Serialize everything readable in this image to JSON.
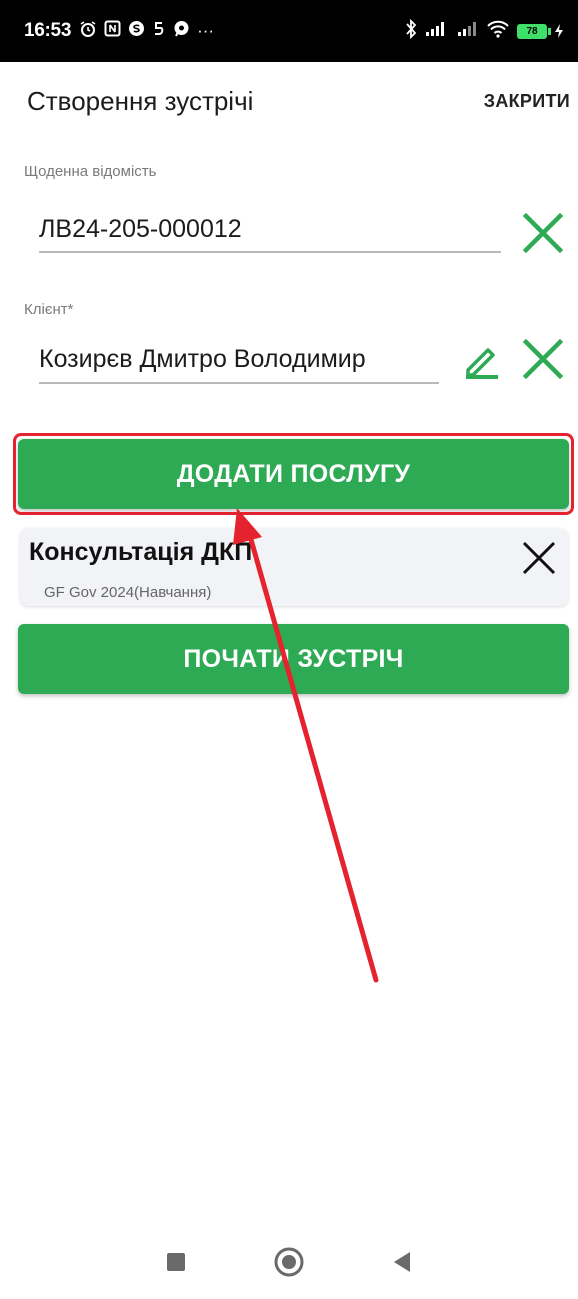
{
  "status_bar": {
    "time": "16:53",
    "left_icons": [
      "alarm-icon",
      "nfc-icon",
      "skype-icon",
      "notification-icon",
      "messenger-icon",
      "more-icon"
    ],
    "more_text": "···",
    "battery_level": "78"
  },
  "header": {
    "title": "Створення зустрічі",
    "close_label": "ЗАКРИТИ"
  },
  "daily_sheet": {
    "label": "Щоденна відомість",
    "value": "ЛВ24-205-000012"
  },
  "client": {
    "label": "Клієнт*",
    "value": "Козирєв Дмитро Володимир"
  },
  "add_service_button": {
    "label": "ДОДАТИ ПОСЛУГУ"
  },
  "service_item": {
    "title": "Консультація ДКП",
    "subtitle": "GF Gov 2024(Навчання)"
  },
  "start_meeting_button": {
    "label": "ПОЧАТИ ЗУСТРІЧ"
  },
  "colors": {
    "accent_green": "#2eaa55",
    "highlight_red": "#e5232f"
  }
}
